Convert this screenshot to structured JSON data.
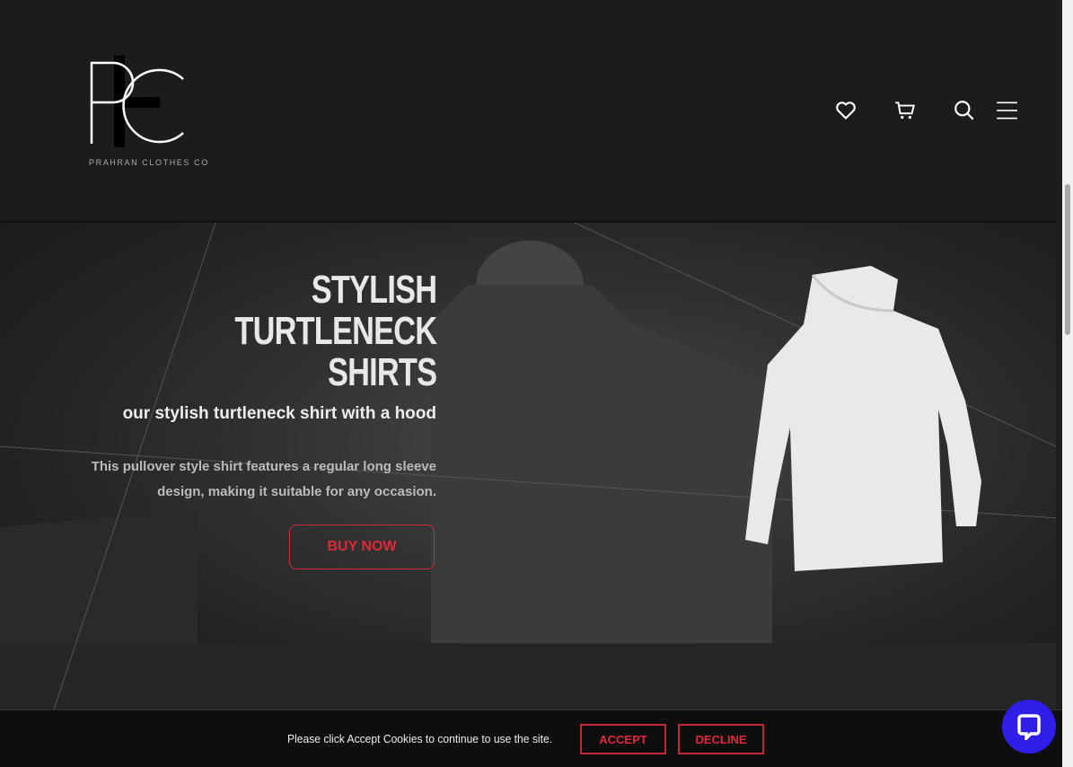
{
  "brand": {
    "logo_letters": "PC",
    "name": "PRAHRAN CLOTHES CO"
  },
  "header": {
    "icons": [
      "heart-icon",
      "cart-icon",
      "search-icon",
      "menu-icon"
    ]
  },
  "hero": {
    "title_lines": [
      "STYLISH",
      "TURTLENECK",
      "SHIRTS"
    ],
    "subtitle": "our stylish turtleneck shirt with a hood",
    "description": "This pullover style shirt features a regular long sleeve design, making it suitable for any occasion.",
    "cta": "BUY NOW"
  },
  "cookie": {
    "message": "Please click Accept Cookies to continue to use the site.",
    "accept": "ACCEPT",
    "decline": "DECLINE"
  },
  "colors": {
    "accent": "#e0283a",
    "chat": "#2f1ee8",
    "background": "#1c1c1d"
  }
}
